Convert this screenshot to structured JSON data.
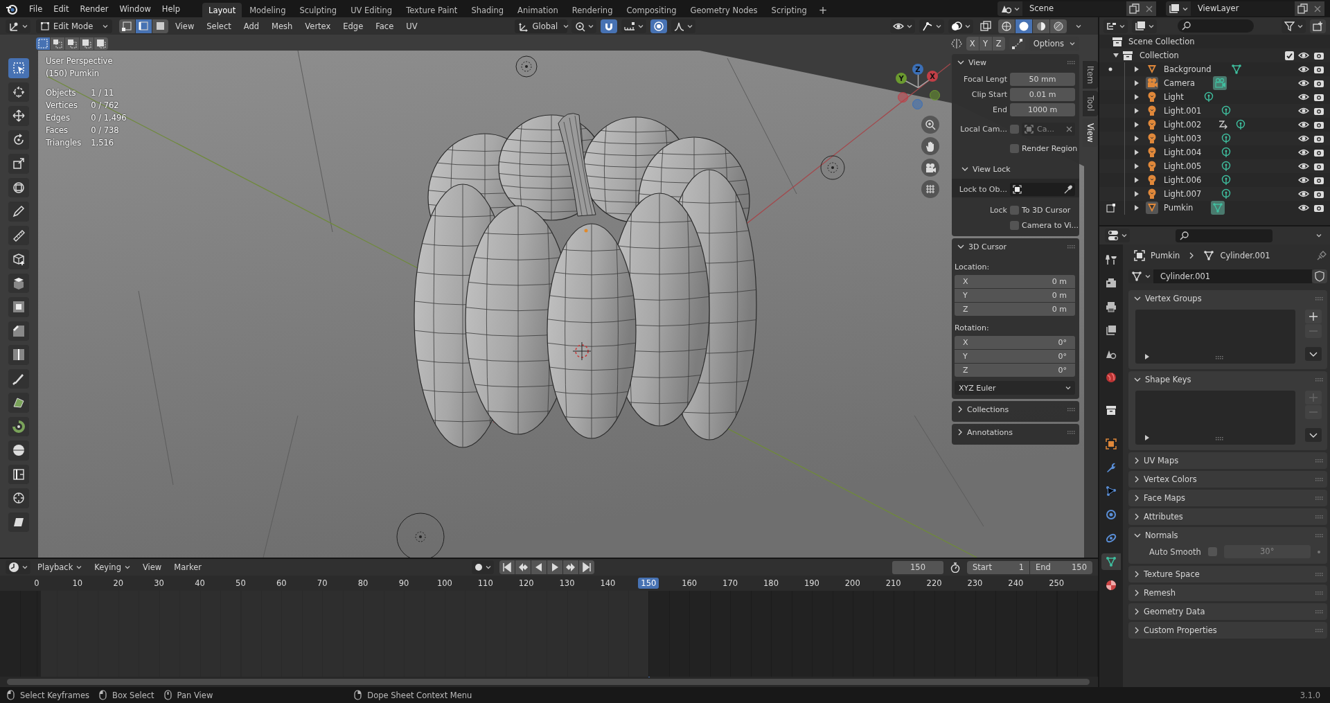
{
  "topbar": {
    "menus": [
      "File",
      "Edit",
      "Render",
      "Window",
      "Help"
    ],
    "workspaces": [
      {
        "label": "Layout",
        "selected": true
      },
      {
        "label": "Modeling",
        "selected": false
      },
      {
        "label": "Sculpting",
        "selected": false
      },
      {
        "label": "UV Editing",
        "selected": false
      },
      {
        "label": "Texture Paint",
        "selected": false
      },
      {
        "label": "Shading",
        "selected": false
      },
      {
        "label": "Animation",
        "selected": false
      },
      {
        "label": "Rendering",
        "selected": false
      },
      {
        "label": "Compositing",
        "selected": false
      },
      {
        "label": "Geometry Nodes",
        "selected": false
      },
      {
        "label": "Scripting",
        "selected": false
      }
    ],
    "add_tab": "+",
    "scene": "Scene",
    "view_layer": "ViewLayer"
  },
  "viewport": {
    "header": {
      "mode": "Edit Mode",
      "select_modes": [
        {
          "selected": false
        },
        {
          "selected": true
        },
        {
          "selected": false
        }
      ],
      "menus": [
        "View",
        "Select",
        "Add",
        "Mesh",
        "Vertex",
        "Edge",
        "Face",
        "UV"
      ],
      "orientation": "Global"
    },
    "tool_settings": {
      "axes": [
        "X",
        "Y",
        "Z"
      ],
      "options": "Options"
    },
    "overlay": {
      "title": "User Perspective",
      "object": "(150) Pumkin",
      "stats": [
        {
          "label": "Objects",
          "value": "1 / 11"
        },
        {
          "label": "Vertices",
          "value": "0 / 762"
        },
        {
          "label": "Edges",
          "value": "0 / 1,496"
        },
        {
          "label": "Faces",
          "value": "0 / 738"
        },
        {
          "label": "Triangles",
          "value": "1,516"
        }
      ]
    },
    "gizmo": {
      "axes": [
        "X",
        "Y",
        "Z"
      ]
    },
    "tools": [
      {
        "selected": true
      },
      {
        "selected": false
      },
      {
        "selected": false
      },
      {
        "selected": false
      },
      {
        "selected": false
      },
      {
        "selected": false
      },
      {
        "selected": false
      },
      {
        "selected": false
      },
      {
        "selected": false
      },
      {
        "selected": false
      },
      {
        "selected": false
      },
      {
        "selected": false
      },
      {
        "selected": false
      },
      {
        "selected": false
      },
      {
        "selected": false
      },
      {
        "selected": false
      },
      {
        "selected": false
      },
      {
        "selected": false
      },
      {
        "selected": false
      },
      {
        "selected": false
      }
    ]
  },
  "n_panel": {
    "tabs": [
      {
        "label": "Item",
        "selected": false
      },
      {
        "label": "Tool",
        "selected": false
      },
      {
        "label": "View",
        "selected": true
      }
    ],
    "panels": [
      {
        "title": "View",
        "expanded": true,
        "rows": [
          {
            "kind": "number",
            "label": "Focal Lengt",
            "value": "50 mm"
          },
          {
            "kind": "number",
            "label": "Clip Start",
            "value": "0.01 m"
          },
          {
            "kind": "number",
            "label": "End",
            "value": "1000 m"
          },
          {
            "kind": "object",
            "label": "Local Cam...",
            "checked": false,
            "placeholder": "Ca..."
          },
          {
            "kind": "check",
            "label": "Render Region",
            "checked": false
          },
          {
            "kind": "subpanel",
            "label": "View Lock",
            "expanded": true
          },
          {
            "kind": "picker",
            "label": "Lock to Ob..."
          },
          {
            "kind": "check",
            "prefix": "Lock",
            "label": "To 3D Cursor",
            "checked": false
          },
          {
            "kind": "check",
            "label": "Camera to Vi...",
            "checked": false
          }
        ]
      },
      {
        "title": "3D Cursor",
        "expanded": true,
        "rows": [
          {
            "kind": "heading",
            "label": "Location:"
          },
          {
            "kind": "vector",
            "items": [
              {
                "axis": "X",
                "value": "0 m"
              },
              {
                "axis": "Y",
                "value": "0 m"
              },
              {
                "axis": "Z",
                "value": "0 m"
              }
            ]
          },
          {
            "kind": "heading",
            "label": "Rotation:"
          },
          {
            "kind": "vector",
            "items": [
              {
                "axis": "X",
                "value": "0°"
              },
              {
                "axis": "Y",
                "value": "0°"
              },
              {
                "axis": "Z",
                "value": "0°"
              }
            ]
          },
          {
            "kind": "dropdown",
            "value": "XYZ Euler"
          }
        ]
      },
      {
        "title": "Collections",
        "expanded": false
      },
      {
        "title": "Annotations",
        "expanded": false
      }
    ]
  },
  "outliner": {
    "root": "Scene Collection",
    "collection": {
      "name": "Collection",
      "checked": true,
      "children": [
        {
          "name": "Background",
          "kind": "mesh",
          "active": false,
          "mode_dot": true,
          "edit_mode": false,
          "constraint": false
        },
        {
          "name": "Camera",
          "kind": "camera",
          "active": true,
          "mode_dot": false,
          "edit_mode": false,
          "constraint": false
        },
        {
          "name": "Light",
          "kind": "light",
          "active": false,
          "mode_dot": false,
          "edit_mode": false,
          "constraint": false
        },
        {
          "name": "Light.001",
          "kind": "light",
          "active": false,
          "mode_dot": false,
          "edit_mode": false,
          "constraint": false
        },
        {
          "name": "Light.002",
          "kind": "light",
          "active": false,
          "mode_dot": false,
          "edit_mode": false,
          "constraint": true
        },
        {
          "name": "Light.003",
          "kind": "light",
          "active": false,
          "mode_dot": false,
          "edit_mode": false,
          "constraint": false
        },
        {
          "name": "Light.004",
          "kind": "light",
          "active": false,
          "mode_dot": false,
          "edit_mode": false,
          "constraint": false
        },
        {
          "name": "Light.005",
          "kind": "light",
          "active": false,
          "mode_dot": false,
          "edit_mode": false,
          "constraint": false
        },
        {
          "name": "Light.006",
          "kind": "light",
          "active": false,
          "mode_dot": false,
          "edit_mode": false,
          "constraint": false
        },
        {
          "name": "Light.007",
          "kind": "light",
          "active": false,
          "mode_dot": false,
          "edit_mode": false,
          "constraint": false
        },
        {
          "name": "Pumkin",
          "kind": "mesh",
          "active": true,
          "mode_dot": false,
          "edit_mode": true,
          "constraint": false
        }
      ]
    }
  },
  "properties": {
    "tabs": [
      {
        "selected": false
      },
      {
        "selected": false
      },
      {
        "selected": false
      },
      {
        "selected": false
      },
      {
        "selected": false
      },
      {
        "selected": false
      },
      {
        "selected": false
      },
      {
        "selected": false
      },
      {
        "selected": false
      },
      {
        "selected": false
      },
      {
        "selected": false
      },
      {
        "selected": false
      },
      {
        "selected": true
      },
      {
        "selected": false
      }
    ],
    "breadcrumb": [
      "Pumkin",
      "Cylinder.001"
    ],
    "data_name": "Cylinder.001",
    "panels": [
      {
        "title": "Vertex Groups",
        "expanded": true,
        "kind": "list"
      },
      {
        "title": "Shape Keys",
        "expanded": true,
        "kind": "list"
      },
      {
        "title": "UV Maps",
        "expanded": false
      },
      {
        "title": "Vertex Colors",
        "expanded": false
      },
      {
        "title": "Face Maps",
        "expanded": false
      },
      {
        "title": "Attributes",
        "expanded": false
      },
      {
        "title": "Normals",
        "expanded": true,
        "kind": "normals",
        "auto_smooth": {
          "label": "Auto Smooth",
          "checked": false,
          "angle": "30°"
        }
      },
      {
        "title": "Texture Space",
        "expanded": false
      },
      {
        "title": "Remesh",
        "expanded": false
      },
      {
        "title": "Geometry Data",
        "expanded": false
      },
      {
        "title": "Custom Properties",
        "expanded": false
      }
    ]
  },
  "timeline": {
    "menus": [
      {
        "label": "Playback",
        "dropdown": true
      },
      {
        "label": "Keying",
        "dropdown": true
      },
      {
        "label": "View",
        "dropdown": false
      },
      {
        "label": "Marker",
        "dropdown": false
      }
    ],
    "current_frame": "150",
    "start_label": "Start",
    "start": "1",
    "end_label": "End",
    "end": "150",
    "ticks": [
      {
        "label": "0",
        "selected": false
      },
      {
        "label": "10",
        "selected": false
      },
      {
        "label": "20",
        "selected": false
      },
      {
        "label": "30",
        "selected": false
      },
      {
        "label": "40",
        "selected": false
      },
      {
        "label": "50",
        "selected": false
      },
      {
        "label": "60",
        "selected": false
      },
      {
        "label": "70",
        "selected": false
      },
      {
        "label": "80",
        "selected": false
      },
      {
        "label": "90",
        "selected": false
      },
      {
        "label": "100",
        "selected": false
      },
      {
        "label": "110",
        "selected": false
      },
      {
        "label": "120",
        "selected": false
      },
      {
        "label": "130",
        "selected": false
      },
      {
        "label": "140",
        "selected": false
      },
      {
        "label": "150",
        "selected": true
      },
      {
        "label": "160",
        "selected": false
      },
      {
        "label": "170",
        "selected": false
      },
      {
        "label": "180",
        "selected": false
      },
      {
        "label": "190",
        "selected": false
      },
      {
        "label": "200",
        "selected": false
      },
      {
        "label": "210",
        "selected": false
      },
      {
        "label": "220",
        "selected": false
      },
      {
        "label": "230",
        "selected": false
      },
      {
        "label": "240",
        "selected": false
      },
      {
        "label": "250",
        "selected": false
      }
    ]
  },
  "status_bar": {
    "hints": [
      "Select Keyframes",
      "Box Select",
      "Pan View",
      "Dope Sheet Context Menu"
    ],
    "version": "3.1.0"
  }
}
